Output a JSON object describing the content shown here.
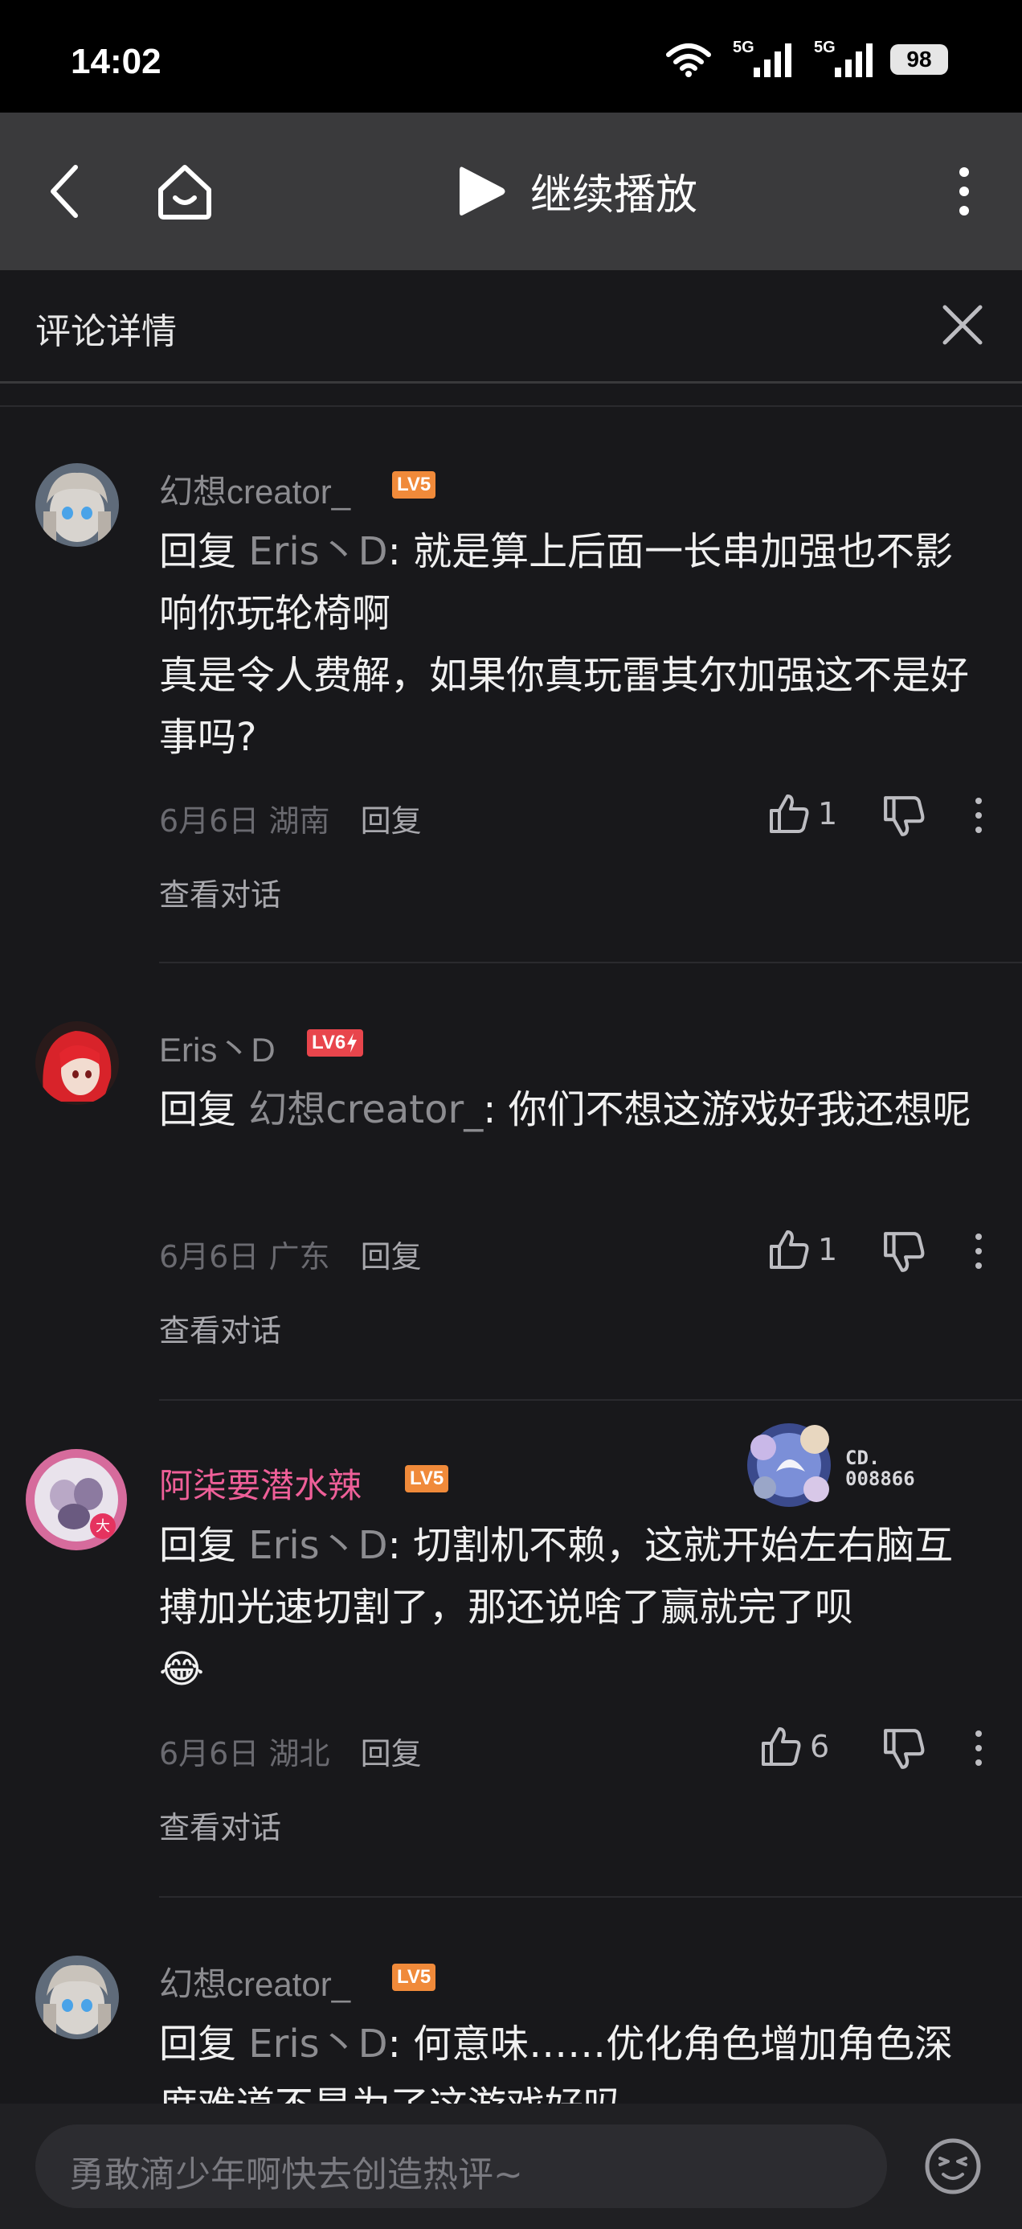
{
  "status": {
    "time": "14:02",
    "net1": "5G",
    "net2": "5G",
    "battery": "98"
  },
  "toolbar": {
    "play_label": "继续播放",
    "icons": [
      "back-icon",
      "home-icon",
      "play-icon",
      "more-vertical-icon"
    ]
  },
  "header": {
    "title": "评论详情"
  },
  "comments": [
    {
      "user": "幻想creator_",
      "level": "LV5",
      "reply_prefix": "回复 ",
      "reply_to": "Eris丶D",
      "text": ": 就是算上后面一长串加强也不影响你玩轮椅啊",
      "text2": "真是令人费解，如果你真玩雷其尔加强这不是好事吗?",
      "date": "6月6日",
      "location": "湖南",
      "reply_label": "回复",
      "likes": "1",
      "view_conv": "查看对话"
    },
    {
      "user": "Eris丶D",
      "level": "LV6",
      "reply_prefix": "回复 ",
      "reply_to": "幻想creator_",
      "text": ": 你们不想这游戏好我还想呢",
      "date": "6月6日",
      "location": "广东",
      "reply_label": "回复",
      "likes": "1",
      "view_conv": "查看对话"
    },
    {
      "user": "阿柒要潜水辣",
      "level": "LV5",
      "reply_prefix": "回复 ",
      "reply_to": "Eris丶D",
      "text": ": 切割机不赖，这就开始左右脑互搏加光速切割了，那还说啥了赢就完了呗",
      "emoji": "😂",
      "fan_id_1": "CD.",
      "fan_id_2": "008866",
      "date": "6月6日",
      "location": "湖北",
      "reply_label": "回复",
      "likes": "6",
      "view_conv": "查看对话"
    },
    {
      "user": "幻想creator_",
      "level": "LV5",
      "reply_prefix": "回复 ",
      "reply_to": "Eris丶D",
      "text": ": 何意味……优化角色增加角色深度难道不是为了这游戏好吗"
    }
  ],
  "input": {
    "placeholder": "勇敢滴少年啊快去创造热评~"
  },
  "colors": {
    "bg": "#18181b",
    "toolbar": "#3a3a3c",
    "level_orange": "#f08a3a",
    "level_red": "#e8454c",
    "pink_name": "#ee5f98"
  }
}
